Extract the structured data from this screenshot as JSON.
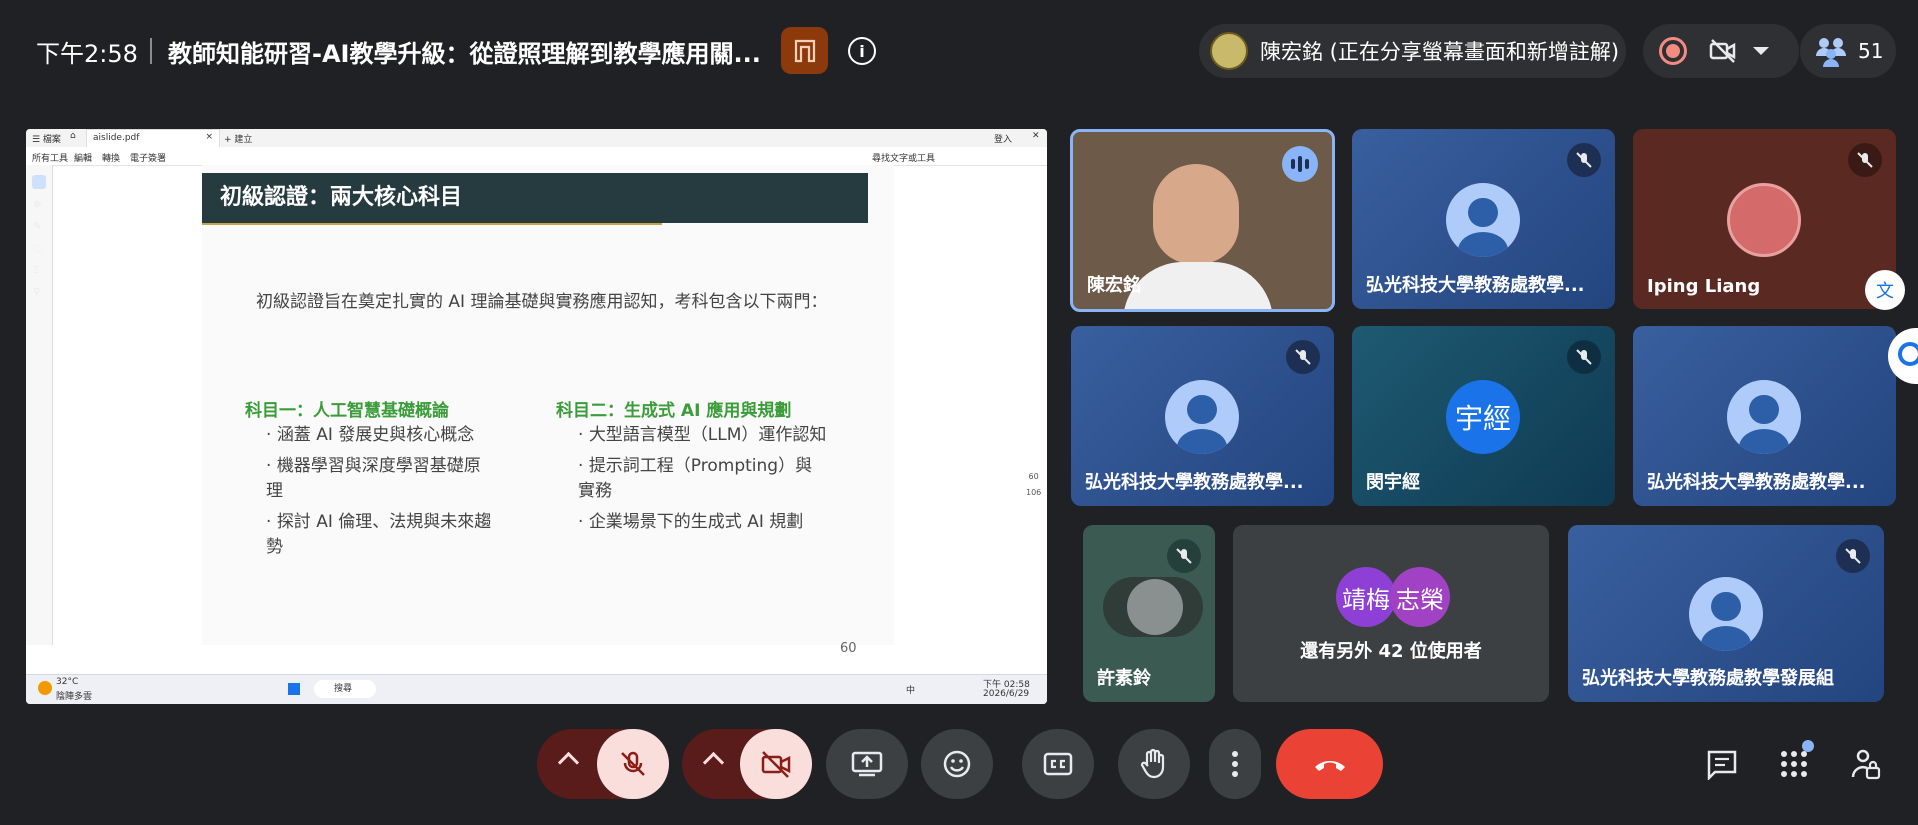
{
  "topbar": {
    "time": "下午2:58",
    "meeting_title": "教師知能研習-AI教學升級：從證照理解到教學應用關...",
    "presenter_label": "陳宏銘 (正在分享螢幕畫面和新增註解)",
    "participant_count": "51"
  },
  "share": {
    "viewer": {
      "tab_label": "aislide.pdf",
      "menu": [
        "所有工具",
        "編輯",
        "轉換",
        "電子簽署"
      ],
      "search_hint": "尋找文字或工具",
      "sign_in": "登入",
      "zoom_values": [
        "60",
        "106"
      ]
    },
    "slide": {
      "title": "初級認證：兩大核心科目",
      "intro": "初級認證旨在奠定扎實的 AI 理論基礎與實務應用認知，考科包含以下兩門：",
      "subject1": {
        "title": "科目一：人工智慧基礎概論",
        "items": [
          "涵蓋 AI 發展史與核心概念",
          "機器學習與深度學習基礎原理",
          "探討 AI 倫理、法規與未來趨勢"
        ]
      },
      "subject2": {
        "title": "科目二：生成式 AI 應用與規劃",
        "items": [
          "大型語言模型（LLM）運作認知",
          "提示詞工程（Prompting）與實務",
          "企業場景下的生成式 AI 規劃"
        ]
      },
      "page_number": "60"
    },
    "taskbar": {
      "weather_temp": "32°C",
      "weather_desc": "陰陣多雲",
      "search": "搜尋",
      "ime": "中",
      "clock_time": "下午 02:58",
      "clock_date": "2026/6/29"
    }
  },
  "tiles": [
    {
      "name": "陳宏銘"
    },
    {
      "name": "弘光科技大學教務處教學..."
    },
    {
      "name": "Iping Liang"
    },
    {
      "name": "弘光科技大學教務處教學..."
    },
    {
      "name": "閔宇經",
      "initials": "宇經"
    },
    {
      "name": "弘光科技大學教務處教學..."
    },
    {
      "name": "許素鈴"
    },
    {
      "others_label": "還有另外 42 位使用者",
      "initials_a": "靖梅",
      "initials_b": "志榮"
    },
    {
      "name": "弘光科技大學教務處教學發展組"
    }
  ],
  "colors": {
    "background": "#202124",
    "mic_off_red": "#f9dedc",
    "end_call": "#ea4335",
    "tile_blue": "#2d4f8c",
    "avatar_purple": "#8e3fd6",
    "avatar_blue": "#1a73e8"
  }
}
